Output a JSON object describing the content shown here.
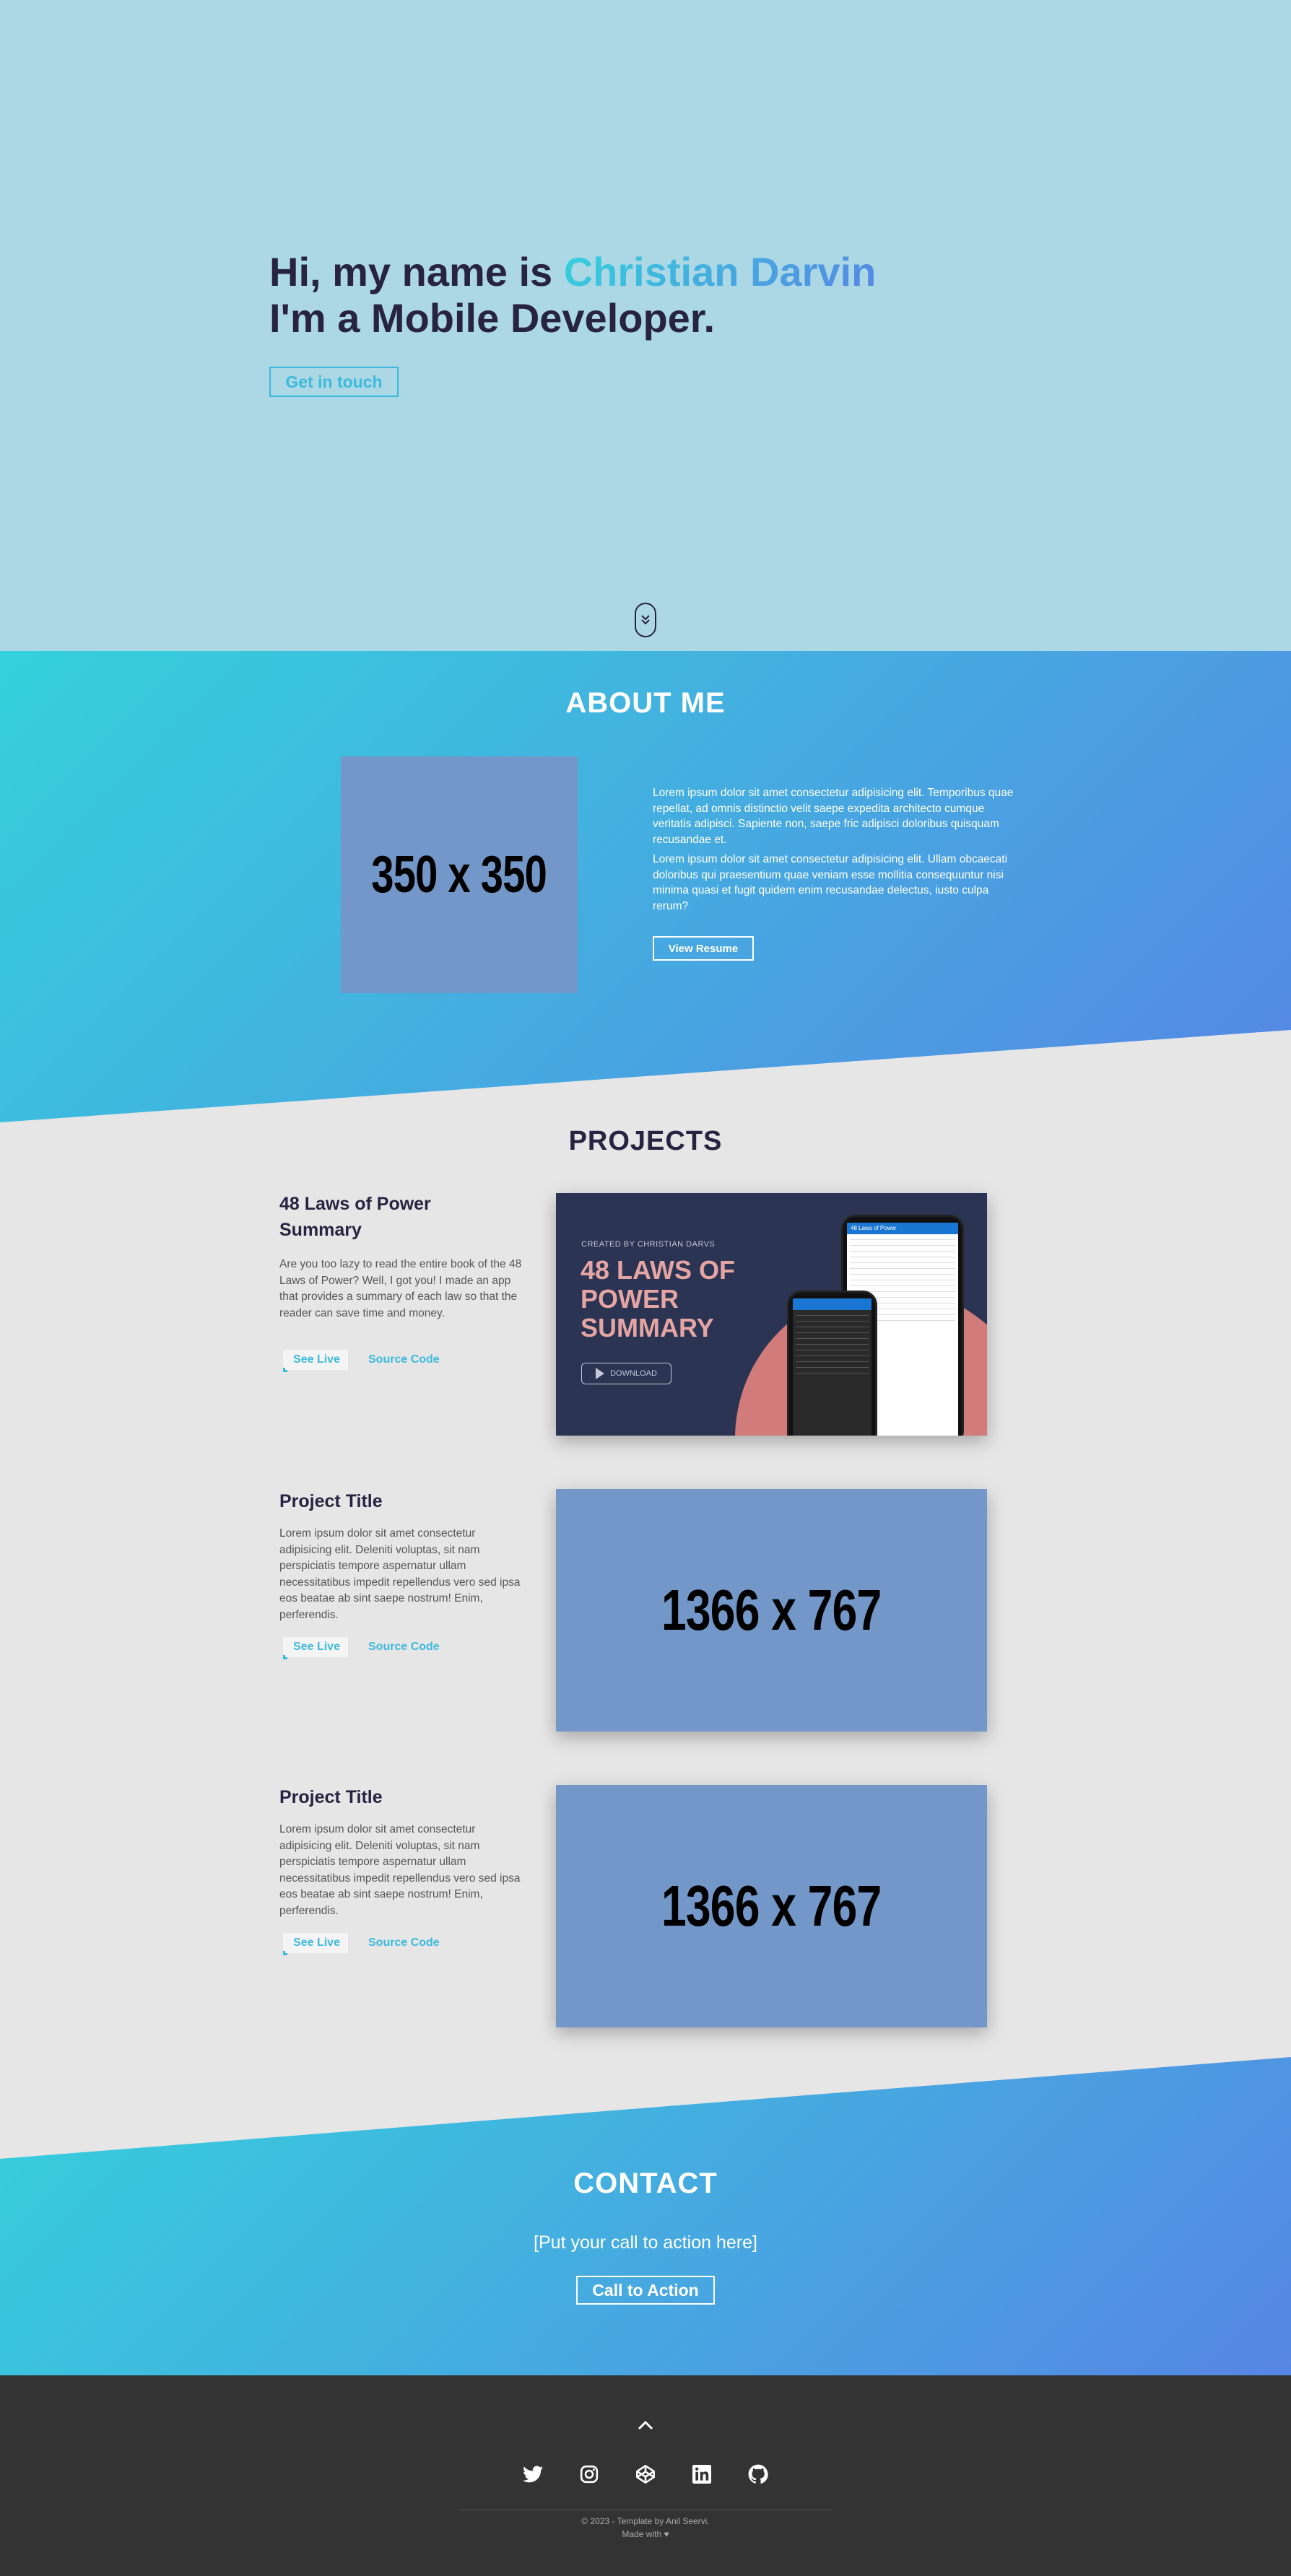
{
  "hero": {
    "greeting": "Hi, my name is ",
    "name": "Christian Darvin",
    "tagline": "I'm a Mobile Developer.",
    "cta_label": "Get in touch"
  },
  "about": {
    "heading": "ABOUT ME",
    "image_placeholder": "350 x 350",
    "paragraph1": "Lorem ipsum dolor sit amet consectetur adipisicing elit. Temporibus quae repellat, ad omnis distinctio velit saepe expedita architecto cumque veritatis adipisci. Sapiente non, saepe fric adipisci doloribus quisquam recusandae et.",
    "paragraph2": "Lorem ipsum dolor sit amet consectetur adipisicing elit. Ullam obcaecati doloribus qui praesentium quae veniam esse mollitia consequuntur nisi minima quasi et fugit quidem enim recusandae delectus, iusto culpa rerum?",
    "resume_label": "View Resume"
  },
  "projects": {
    "heading": "PROJECTS",
    "items": [
      {
        "title": "48 Laws of Power Summary",
        "description": "Are you too lazy to read the entire book of the 48 Laws of Power? Well, I got you! I made an app that provides a summary of each law so that the reader can save time and money.",
        "live_label": "See Live",
        "code_label": "Source Code",
        "image": {
          "created_by": "CREATED BY CHRISTIAN DARVS",
          "title": "48 LAWS OF POWER SUMMARY",
          "download_label": "DOWNLOAD",
          "app_bar": "48 Laws of Power"
        }
      },
      {
        "title": "Project Title",
        "description": "Lorem ipsum dolor sit amet consectetur adipisicing elit. Deleniti voluptas, sit nam perspiciatis tempore aspernatur ullam necessitatibus impedit repellendus vero sed ipsa eos beatae ab sint saepe nostrum! Enim, perferendis.",
        "live_label": "See Live",
        "code_label": "Source Code",
        "image_placeholder": "1366 x 767"
      },
      {
        "title": "Project Title",
        "description": "Lorem ipsum dolor sit amet consectetur adipisicing elit. Deleniti voluptas, sit nam perspiciatis tempore aspernatur ullam necessitatibus impedit repellendus vero sed ipsa eos beatae ab sint saepe nostrum! Enim, perferendis.",
        "live_label": "See Live",
        "code_label": "Source Code",
        "image_placeholder": "1366 x 767"
      }
    ]
  },
  "contact": {
    "heading": "CONTACT",
    "subtitle": "[Put your call to action here]",
    "cta_label": "Call to Action"
  },
  "footer": {
    "socials": [
      "twitter-icon",
      "instagram-icon",
      "codepen-icon",
      "linkedin-icon",
      "github-icon"
    ],
    "copyright": "© 2023 - Template by Anil Seervi.",
    "made_with": "Made with ♥"
  },
  "colors": {
    "primary": "#272341",
    "accent_start": "#34d1dc",
    "accent_end": "#5686e4",
    "hero_bg": "#abd8e4",
    "footer_bg": "#333333"
  }
}
